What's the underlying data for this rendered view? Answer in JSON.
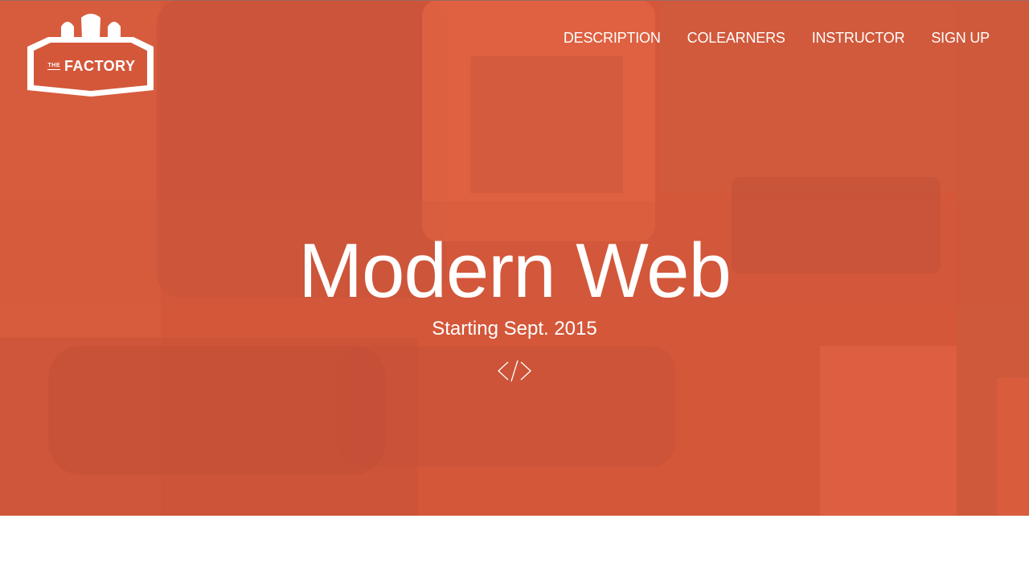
{
  "brand": {
    "logo_small": "THE",
    "logo_word": "FACTORY"
  },
  "nav": {
    "items": [
      {
        "label": "DESCRIPTION"
      },
      {
        "label": "COLEARNERS"
      },
      {
        "label": "INSTRUCTOR"
      },
      {
        "label": "SIGN UP"
      }
    ]
  },
  "hero": {
    "title": "Modern Web",
    "subtitle": "Starting Sept. 2015",
    "icon": "code-brackets-icon"
  },
  "colors": {
    "accent": "#d4573a",
    "text": "#ffffff",
    "page_background": "#ffffff"
  }
}
